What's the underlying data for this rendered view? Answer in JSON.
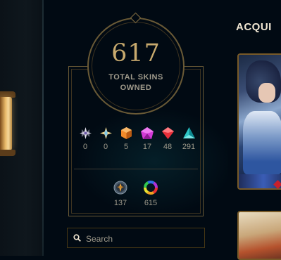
{
  "collection": {
    "total_count": "617",
    "total_label_line1": "TOTAL SKINS",
    "total_label_line2": "OWNED"
  },
  "rarities": [
    {
      "icon": "transcendent-gem-icon",
      "count": "0",
      "color": "#e6e4f0"
    },
    {
      "icon": "ultimate-gem-icon",
      "count": "0",
      "color": "#f2d48a"
    },
    {
      "icon": "mythic-gem-icon",
      "count": "5",
      "color": "#f08a2a"
    },
    {
      "icon": "legendary-gem-icon",
      "count": "17",
      "color": "#d23ad6"
    },
    {
      "icon": "epic-gem-icon",
      "count": "48",
      "color": "#e8303a"
    },
    {
      "icon": "common-gem-icon",
      "count": "291",
      "color": "#2ec6c6"
    }
  ],
  "currencies": [
    {
      "icon": "orange-essence-icon",
      "count": "137"
    },
    {
      "icon": "chroma-wheel-icon",
      "count": "615"
    }
  ],
  "search": {
    "placeholder": "Search"
  },
  "acquisition": {
    "title": "ACQUI"
  }
}
